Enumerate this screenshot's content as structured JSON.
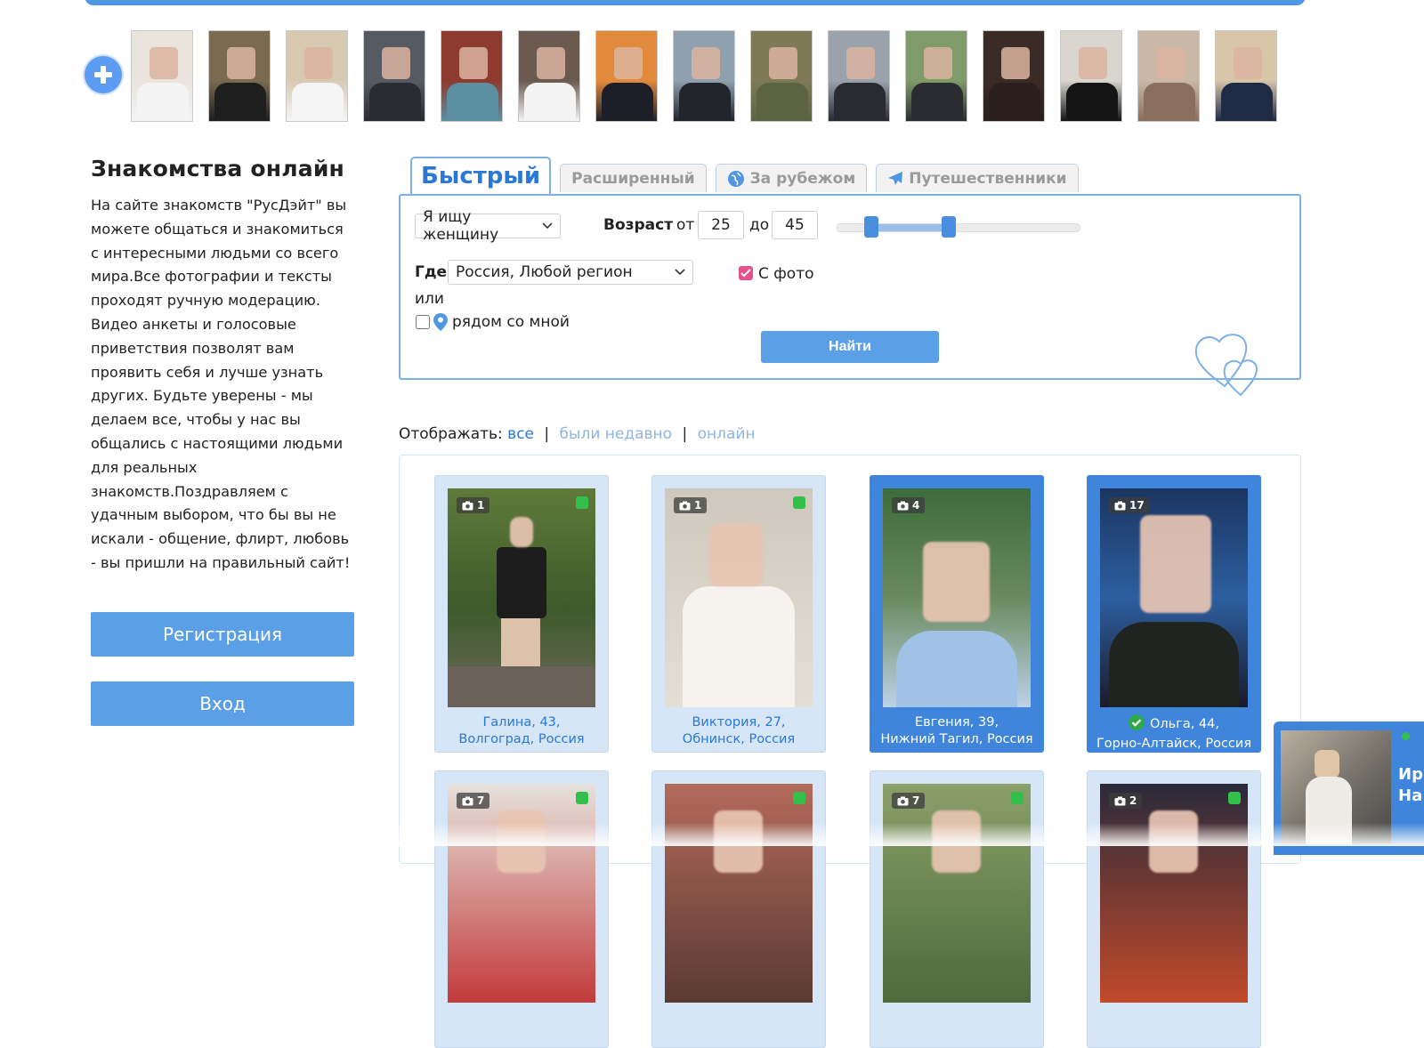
{
  "header": {
    "add_icon": "plus-icon"
  },
  "photo_strip": {
    "count": 15
  },
  "intro": {
    "title": "Знакомства онлайн",
    "text": "На сайте знакомств \"РусДэйт\" вы можете общаться и знакомиться с интересными людьми со всего мира.Все фотографии и тексты проходят ручную модерацию. Видео анкеты и голосовые приветствия позволят вам проявить себя и лучше узнать других. Будьте уверены - мы делаем все, чтобы у нас вы общались с настоящими людьми для реальных знакомств.Поздравляем с удачным выбором, что бы вы не искали - общение, флирт, любовь - вы пришли на правильный сайт!"
  },
  "auth": {
    "register_label": "Регистрация",
    "login_label": "Вход"
  },
  "search": {
    "tabs": [
      {
        "label": "Быстрый",
        "active": true
      },
      {
        "label": "Расширенный"
      },
      {
        "label": "За рубежом",
        "icon": "globe-icon"
      },
      {
        "label": "Путешественники",
        "icon": "airplane-icon"
      }
    ],
    "looking_for": "Я ищу женщину",
    "age_label": "Возраст",
    "from_label": "от",
    "to_label": "до",
    "age_from": "25",
    "age_to": "45",
    "age_slider": {
      "min": 18,
      "max": 99,
      "low": 25,
      "high": 45
    },
    "where_label": "Где",
    "location": "Россия, Любой регион",
    "with_photo_label": "С фото",
    "with_photo_checked": true,
    "or_label": "или",
    "near_me_label": "рядом со мной",
    "near_me_checked": false,
    "find_label": "Найти"
  },
  "show_filter": {
    "label": "Отображать:",
    "all": "все",
    "recent": "были недавно",
    "online": "онлайн",
    "sep": "|"
  },
  "profiles": [
    {
      "name_age": "Галина, 43,",
      "location": "Волгоград, Россия",
      "photos": "1",
      "online": true,
      "vip": false,
      "verified": false
    },
    {
      "name_age": "Виктория, 27,",
      "location": "Обнинск, Россия",
      "photos": "1",
      "online": true,
      "vip": false,
      "verified": false
    },
    {
      "name_age": "Евгения, 39,",
      "location": "Нижний Тагил, Россия",
      "photos": "4",
      "online": false,
      "vip": true,
      "verified": false
    },
    {
      "name_age": "Ольга, 44,",
      "location": "Горно-Алтайск, Россия",
      "photos": "17",
      "online": false,
      "vip": true,
      "verified": true
    },
    {
      "photos": "7",
      "online": true
    },
    {
      "photos": "",
      "online": true
    },
    {
      "photos": "7",
      "online": true
    },
    {
      "photos": "2",
      "online": true
    }
  ],
  "chat_popup": {
    "name_line1": "Ир",
    "name_line2": "На"
  },
  "colors": {
    "accent": "#4f97e3",
    "vip": "#3f85dc",
    "online": "#33c04a",
    "checkbox": "#e8508c"
  }
}
